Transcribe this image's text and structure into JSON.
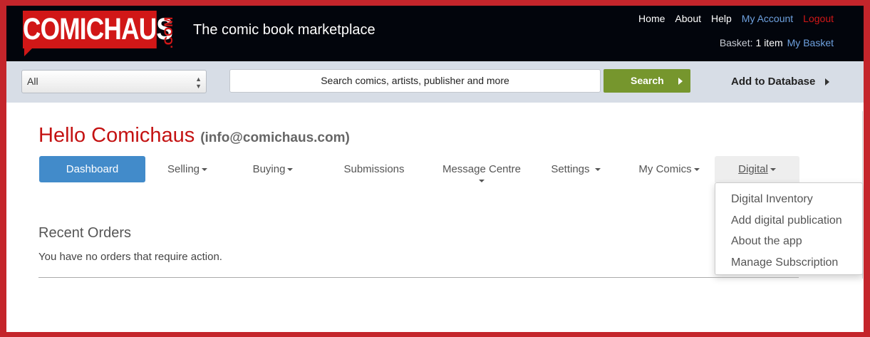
{
  "header": {
    "logo_text": "COMICHAUS",
    "logo_suffix": ".COM",
    "tagline": "The comic book marketplace",
    "nav": {
      "home": "Home",
      "about": "About",
      "help": "Help",
      "my_account": "My Account",
      "logout": "Logout"
    },
    "basket": {
      "label": "Basket:",
      "count": "1 item",
      "my_basket": "My Basket"
    }
  },
  "search": {
    "category_selected": "All",
    "placeholder": "Search comics, artists, publisher and more",
    "button_label": "Search",
    "add_to_database": "Add to Database"
  },
  "greeting": {
    "hello": "Hello Comichaus",
    "email": "(info@comichaus.com)"
  },
  "tabs": [
    {
      "label": "Dashboard"
    },
    {
      "label": "Selling"
    },
    {
      "label": "Buying"
    },
    {
      "label": "Submissions"
    },
    {
      "label": "Message Centre"
    },
    {
      "label": "Settings"
    },
    {
      "label": "My Comics"
    },
    {
      "label": "Digital"
    }
  ],
  "digital_menu": [
    "Digital Inventory",
    "Add digital publication",
    "About the app",
    "Manage Subscription"
  ],
  "recent_orders": {
    "title": "Recent Orders",
    "message": "You have no orders that require action."
  },
  "colors": {
    "brand_red": "#d11717",
    "header_bg": "#02050c",
    "link_blue": "#6ea1df",
    "search_green": "#76962d",
    "active_tab": "#428bca"
  }
}
